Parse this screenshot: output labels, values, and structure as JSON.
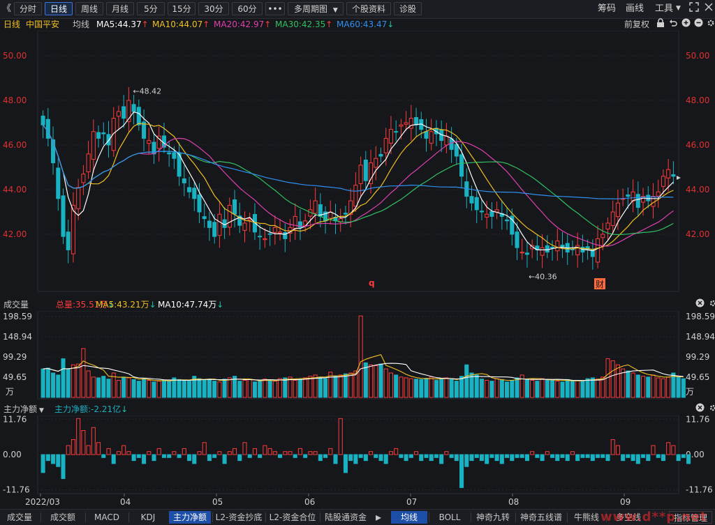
{
  "toolbar": {
    "collapse_icon": "《",
    "periods": [
      "分时",
      "日线",
      "周线",
      "月线",
      "5分",
      "15分",
      "30分",
      "60分"
    ],
    "active_period": "日线",
    "more_label": "•••",
    "multi_period_label": "多周期图",
    "stock_info_label": "个股资料",
    "diagnose_label": "诊股",
    "right_items": [
      "筹码",
      "画线",
      "工具"
    ]
  },
  "ma_bar": {
    "period": "日线",
    "stock_name": "中国平安",
    "ma_label": "均线",
    "ma5": "MA5:44.37",
    "ma10": "MA10:44.07",
    "ma20": "MA20:42.97",
    "ma30": "MA30:42.35",
    "ma60": "MA60:43.47",
    "adjust_label": "前复权"
  },
  "volume_bar": {
    "title": "成交量",
    "total": "总量:35.51万",
    "ma5": "MA5:43.21万",
    "ma10": "MA10:47.74万"
  },
  "flow_bar": {
    "title": "主力净额",
    "value": "主力净额:-2.21亿"
  },
  "colors": {
    "up": "#ff3b3b",
    "down": "#19b2c2",
    "ma5": "#ffffff",
    "ma10": "#f0c020",
    "ma20": "#e040b0",
    "ma30": "#30c060",
    "ma60": "#3090f0",
    "axis_label": "#e03030"
  },
  "chart_data": {
    "type": "candlestick",
    "price_axis": {
      "ticks": [
        "50.00",
        "48.00",
        "46.00",
        "44.00",
        "42.00"
      ],
      "ylim": [
        39.5,
        51
      ]
    },
    "annotations": {
      "high": "48.42",
      "low": "40.36",
      "marker_q": "q",
      "marker_cai": "财"
    },
    "x_dates": [
      "2022/03",
      "04",
      "05",
      "06",
      "07",
      "08",
      "09"
    ],
    "close": [
      46.9,
      46.3,
      45.2,
      43.6,
      41.9,
      41.3,
      43.3,
      44.1,
      44.7,
      45.6,
      46.6,
      46.3,
      46.5,
      46.0,
      47.2,
      47.5,
      47.2,
      48.0,
      47.5,
      46.9,
      46.3,
      46.2,
      45.6,
      46.4,
      45.9,
      45.6,
      45.4,
      44.6,
      44.3,
      43.9,
      43.6,
      43.0,
      42.7,
      42.3,
      41.9,
      42.9,
      42.3,
      43.3,
      42.9,
      42.4,
      42.5,
      42.7,
      42.1,
      41.9,
      41.8,
      42.0,
      42.3,
      42.1,
      41.8,
      42.3,
      42.8,
      42.3,
      42.6,
      43.1,
      43.5,
      42.8,
      42.6,
      43.0,
      42.6,
      42.7,
      42.9,
      43.5,
      44.2,
      45.1,
      44.4,
      45.2,
      45.4,
      45.5,
      46.3,
      46.7,
      46.6,
      46.9,
      47.0,
      47.2,
      46.9,
      46.7,
      46.3,
      46.6,
      46.5,
      46.2,
      46.4,
      45.8,
      45.5,
      44.6,
      43.7,
      43.4,
      43.1,
      43.0,
      42.9,
      42.8,
      43.1,
      42.8,
      42.6,
      42.0,
      41.4,
      41.2,
      41.1,
      41.5,
      41.3,
      41.4,
      41.2,
      41.4,
      41.7,
      41.4,
      41.2,
      41.3,
      41.5,
      41.2,
      41.3,
      41.0,
      41.8,
      42.0,
      42.5,
      43.0,
      43.4,
      43.6,
      43.7,
      43.9,
      43.2,
      43.7,
      43.5,
      43.7,
      43.9,
      44.6,
      44.9,
      44.6
    ],
    "volume_axis": {
      "ticks": [
        "198.59",
        "148.94",
        "99.29",
        "49.65"
      ],
      "unit": "万",
      "ylim": [
        0,
        198.59
      ]
    },
    "volume": [
      70,
      72,
      60,
      55,
      95,
      70,
      80,
      82,
      120,
      65,
      50,
      48,
      52,
      45,
      60,
      42,
      50,
      48,
      44,
      40,
      45,
      42,
      38,
      40,
      43,
      40,
      48,
      44,
      41,
      40,
      52,
      46,
      42,
      45,
      40,
      38,
      45,
      48,
      52,
      40,
      42,
      44,
      38,
      40,
      45,
      42,
      40,
      46,
      48,
      50,
      42,
      45,
      48,
      52,
      55,
      50,
      46,
      62,
      52,
      55,
      58,
      60,
      65,
      200,
      85,
      80,
      78,
      82,
      70,
      60,
      55,
      50,
      48,
      46,
      45,
      44,
      47,
      50,
      42,
      46,
      48,
      44,
      40,
      52,
      80,
      60,
      55,
      45,
      42,
      40,
      46,
      44,
      38,
      42,
      48,
      55,
      45,
      42,
      40,
      46,
      44,
      42,
      40,
      38,
      44,
      40,
      42,
      40,
      46,
      48,
      45,
      50,
      95,
      90,
      80,
      70,
      65,
      60,
      55,
      52,
      50,
      55,
      48,
      46,
      50,
      60,
      50,
      46
    ],
    "flow_axis": {
      "ticks": [
        "11.76",
        "0.00",
        "-11.76"
      ],
      "ylim": [
        -13,
        13
      ]
    },
    "net_flow": [
      -6,
      -2,
      -3,
      -4,
      -8,
      3,
      5,
      12,
      8,
      3,
      9,
      4,
      -1,
      2,
      -3,
      1,
      3,
      1,
      -2,
      -1,
      -3,
      1,
      -2,
      2,
      -1,
      -1,
      1,
      -1,
      2,
      -2,
      -3,
      1,
      4,
      -2,
      -1,
      1,
      -3,
      1,
      2,
      -2,
      4,
      -1,
      2,
      -1,
      3,
      2,
      1,
      -1,
      1,
      1,
      -1,
      2,
      -1,
      1,
      1,
      -2,
      -1,
      2,
      -3,
      12,
      -6,
      -2,
      -3,
      -1,
      -2,
      1,
      -1,
      -2,
      -3,
      1,
      2,
      -1,
      -2,
      -1,
      1,
      -2,
      -1,
      -2,
      -1,
      -3,
      1,
      -1,
      -2,
      -11,
      -4,
      -2,
      -1,
      -2,
      -3,
      -1,
      -2,
      -3,
      -1,
      -2,
      -1,
      -1,
      -2,
      1,
      -1,
      -2,
      1,
      -1,
      -2,
      -1,
      -2,
      1,
      -2,
      -1,
      -1,
      -2,
      -1,
      -1,
      -2,
      5,
      3,
      -2,
      -1,
      -2,
      -3,
      -1,
      -2,
      3,
      -1,
      -2,
      4,
      3,
      -2,
      -1,
      -3
    ]
  },
  "tabs_left": [
    "成交量",
    "成交额",
    "MACD",
    "KDJ",
    "主力净额",
    "L2-资金抄底",
    "L2-资金合位",
    "陆股通资金"
  ],
  "tabs_right": [
    "均线",
    "BOLL",
    "神奇九转",
    "神奇五线谱",
    "牛熊线",
    "多空线"
  ],
  "tabs_active_left": "主力净额",
  "tabs_active_right": "均线",
  "manage_label": "指标管理",
  "arrow_label": "▸",
  "watermark": "www.d**p.net"
}
